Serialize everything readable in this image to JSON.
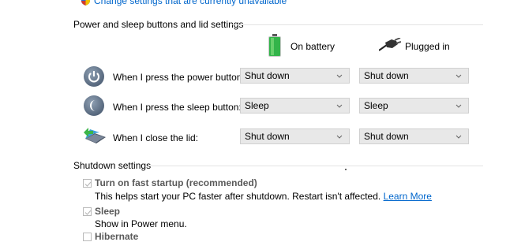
{
  "top_link": "Change settings that are currently unavailable",
  "power_section": {
    "title": "Power and sleep buttons and lid settings",
    "columns": {
      "battery": "On battery",
      "plugged": "Plugged in"
    },
    "rows": [
      {
        "label": "When I press the power button:",
        "battery": "Shut down",
        "plugged": "Shut down"
      },
      {
        "label": "When I press the sleep button:",
        "battery": "Sleep",
        "plugged": "Sleep"
      },
      {
        "label": "When I close the lid:",
        "battery": "Shut down",
        "plugged": "Shut down"
      }
    ]
  },
  "shutdown_section": {
    "title": "Shutdown settings",
    "items": [
      {
        "label": "Turn on fast startup (recommended)",
        "desc": "This helps start your PC faster after shutdown. Restart isn't affected.",
        "link": "Learn More",
        "checked": true
      },
      {
        "label": "Sleep",
        "desc": "Show in Power menu.",
        "checked": true
      },
      {
        "label": "Hibernate",
        "checked": false
      }
    ]
  },
  "colors": {
    "link": "#0066cc",
    "select_bg": "#e8e8e8",
    "disabled_check": "#b9b9b9"
  }
}
